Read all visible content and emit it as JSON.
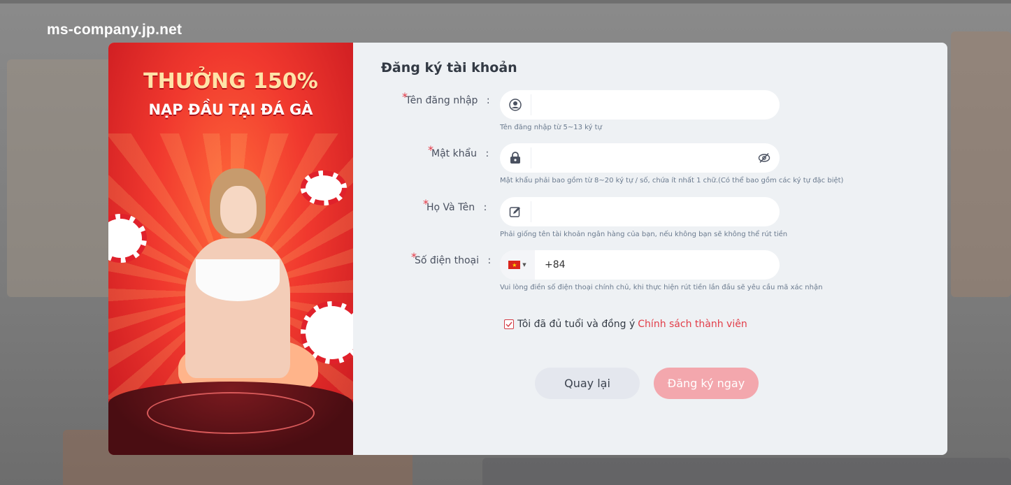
{
  "site_label": "ms-company.jp.net",
  "promo": {
    "line1": "THƯỞNG 150%",
    "line2": "NẠP ĐẦU TẠI ĐÁ GÀ"
  },
  "form": {
    "title": "Đăng ký tài khoản",
    "username": {
      "label": "Tên đăng nhập",
      "value": "",
      "hint": "Tên đăng nhập từ 5~13 ký tự",
      "icon": "user-circle-icon"
    },
    "password": {
      "label": "Mật khẩu",
      "value": "",
      "hint": "Mật khẩu phải bao gồm từ 8~20 ký tự / số, chứa ít nhất 1 chữ.(Có thể bao gồm các ký tự đặc biệt)",
      "icon": "lock-icon",
      "toggle_icon": "eye-off-icon"
    },
    "fullname": {
      "label": "Họ Và Tên",
      "value": "",
      "hint": "Phải giống tên tài khoản ngân hàng của bạn, nếu không bạn sẽ không thể rút tiền",
      "icon": "edit-icon"
    },
    "phone": {
      "label": "Số điện thoại",
      "prefix": "+84",
      "value": "",
      "hint": "Vui lòng điền số điện thoại chính chủ, khi thực hiện rút tiền lần đầu sẽ yêu cầu mã xác nhận",
      "country_flag": "vietnam-flag-icon"
    },
    "agree_text": "Tôi đã đủ tuổi và đồng ý",
    "policy_link": "Chính sách thành viên",
    "back_button": "Quay lại",
    "register_button": "Đăng ký ngay",
    "required_mark": "*",
    "colon": ":"
  },
  "colors": {
    "accent": "#e23d48",
    "register_button": "#f3a7ad",
    "back_button": "#e4e7ee",
    "form_bg": "#eef1f4"
  }
}
